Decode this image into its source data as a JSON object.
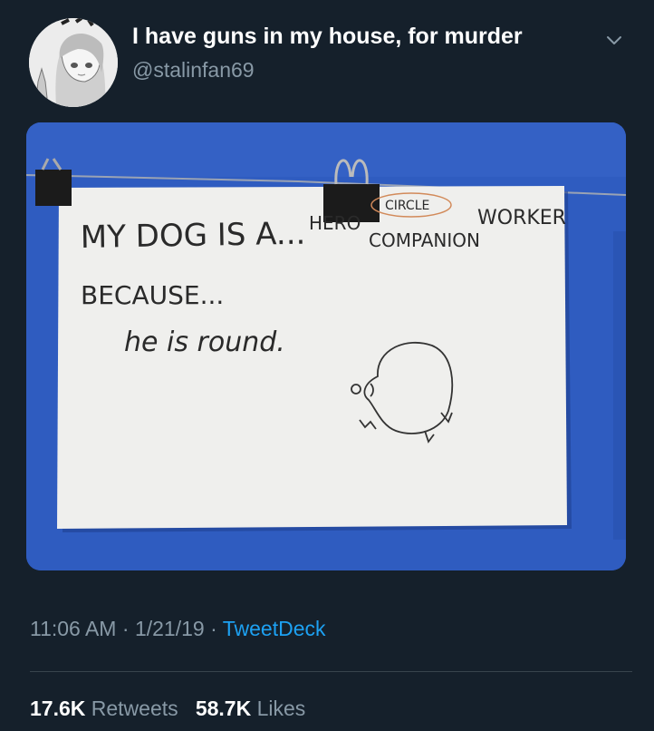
{
  "tweet": {
    "display_name": "I have guns in my house, for murder",
    "handle": "@stalinfan69",
    "time": "11:06 AM",
    "date": "1/21/19",
    "source": "TweetDeck",
    "retweets_count": "17.6K",
    "retweets_label": "Retweets",
    "likes_count": "58.7K",
    "likes_label": "Likes"
  },
  "icons": {
    "more": "chevron-down-icon"
  },
  "photo": {
    "line1": "MY DOG IS A...",
    "option_hero": "HERO",
    "option_circle": "CIRCLE",
    "option_companion": "COMPANION",
    "option_worker": "WORKER",
    "line2": "BECAUSE...",
    "answer": "he is round."
  },
  "colors": {
    "background": "#15202b",
    "secondary_text": "#8899a6",
    "link": "#1da1f2",
    "wall": "#2f5cc0"
  }
}
